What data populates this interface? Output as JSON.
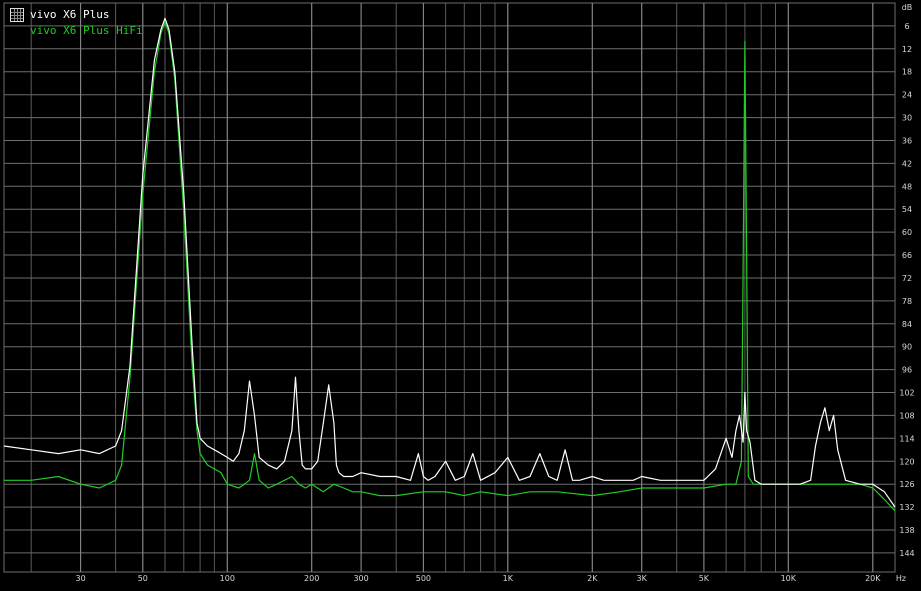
{
  "chart_data": {
    "type": "line",
    "xscale": "log",
    "xlim": [
      16,
      24000
    ],
    "ylim": [
      -149,
      0
    ],
    "x_unit": "Hz",
    "y_unit": "dB",
    "x_ticks": [
      {
        "value": 30,
        "label": "30"
      },
      {
        "value": 50,
        "label": "50"
      },
      {
        "value": 100,
        "label": "100"
      },
      {
        "value": 200,
        "label": "200"
      },
      {
        "value": 300,
        "label": "300"
      },
      {
        "value": 500,
        "label": "500"
      },
      {
        "value": 1000,
        "label": "1K"
      },
      {
        "value": 2000,
        "label": "2K"
      },
      {
        "value": 3000,
        "label": "3K"
      },
      {
        "value": 5000,
        "label": "5K"
      },
      {
        "value": 10000,
        "label": "10K"
      },
      {
        "value": 20000,
        "label": "20K"
      }
    ],
    "y_ticks": [
      -6,
      -12,
      -18,
      -24,
      -30,
      -36,
      -42,
      -48,
      -54,
      -60,
      -66,
      -72,
      -78,
      -84,
      -90,
      -96,
      -102,
      -108,
      -114,
      -120,
      -126,
      -132,
      -138,
      -144
    ],
    "grid": true,
    "legend_position": "top-left",
    "series": [
      {
        "name": "vivo X6 Plus",
        "color": "#ffffff",
        "x": [
          16,
          20,
          25,
          30,
          35,
          40,
          42,
          45,
          50,
          55,
          58,
          60,
          62,
          65,
          70,
          75,
          78,
          80,
          85,
          90,
          95,
          100,
          105,
          110,
          115,
          120,
          125,
          130,
          140,
          150,
          160,
          170,
          175,
          180,
          185,
          190,
          200,
          210,
          220,
          230,
          240,
          245,
          250,
          260,
          280,
          300,
          350,
          400,
          450,
          480,
          500,
          520,
          550,
          600,
          650,
          700,
          750,
          800,
          900,
          1000,
          1100,
          1200,
          1300,
          1400,
          1500,
          1600,
          1700,
          1800,
          2000,
          2200,
          2500,
          2800,
          3000,
          3500,
          4000,
          4500,
          5000,
          5500,
          6000,
          6300,
          6500,
          6700,
          6900,
          7000,
          7100,
          7300,
          7600,
          8000,
          9000,
          10000,
          11000,
          12000,
          12500,
          13000,
          13500,
          14000,
          14500,
          15000,
          16000,
          18000,
          20000,
          22000,
          24000
        ],
        "y": [
          -116,
          -117,
          -118,
          -117,
          -118,
          -116,
          -112,
          -95,
          -45,
          -15,
          -7,
          -4,
          -7,
          -18,
          -50,
          -90,
          -110,
          -114,
          -116,
          -117,
          -118,
          -119,
          -120,
          -118,
          -112,
          -99,
          -108,
          -119,
          -121,
          -122,
          -120,
          -112,
          -98,
          -112,
          -121,
          -122,
          -122,
          -120,
          -110,
          -100,
          -110,
          -121,
          -123,
          -124,
          -124,
          -123,
          -124,
          -124,
          -125,
          -118,
          -124,
          -125,
          -124,
          -120,
          -125,
          -124,
          -118,
          -125,
          -123,
          -119,
          -125,
          -124,
          -118,
          -124,
          -125,
          -117,
          -125,
          -125,
          -124,
          -125,
          -125,
          -125,
          -124,
          -125,
          -125,
          -125,
          -125,
          -122,
          -114,
          -119,
          -112,
          -108,
          -115,
          -102,
          -112,
          -115,
          -125,
          -126,
          -126,
          -126,
          -126,
          -125,
          -116,
          -110,
          -106,
          -112,
          -108,
          -117,
          -125,
          -126,
          -126,
          -128,
          -132
        ]
      },
      {
        "name": "vivo X6 Plus HiFi",
        "color": "#22cc22",
        "x": [
          16,
          20,
          25,
          30,
          35,
          40,
          42,
          45,
          50,
          55,
          58,
          60,
          62,
          65,
          70,
          75,
          78,
          80,
          85,
          90,
          95,
          100,
          110,
          115,
          120,
          125,
          130,
          140,
          150,
          160,
          170,
          180,
          190,
          200,
          220,
          240,
          260,
          280,
          300,
          350,
          400,
          500,
          600,
          700,
          800,
          1000,
          1200,
          1500,
          2000,
          2500,
          3000,
          4000,
          5000,
          6000,
          6500,
          6800,
          6900,
          7000,
          7100,
          7200,
          7500,
          8000,
          9000,
          10000,
          12000,
          14000,
          16000,
          18000,
          20000,
          22000,
          24000
        ],
        "y": [
          -125,
          -125,
          -124,
          -126,
          -127,
          -125,
          -121,
          -98,
          -50,
          -18,
          -8,
          -5,
          -8,
          -20,
          -55,
          -95,
          -112,
          -118,
          -121,
          -122,
          -123,
          -126,
          -127,
          -126,
          -125,
          -118,
          -125,
          -127,
          -126,
          -125,
          -124,
          -126,
          -127,
          -126,
          -128,
          -126,
          -127,
          -128,
          -128,
          -129,
          -129,
          -128,
          -128,
          -129,
          -128,
          -129,
          -128,
          -128,
          -129,
          -128,
          -127,
          -127,
          -127,
          -126,
          -126,
          -120,
          -70,
          -10,
          -65,
          -124,
          -126,
          -126,
          -126,
          -126,
          -126,
          -126,
          -126,
          -126,
          -127,
          -130,
          -133
        ]
      }
    ]
  }
}
